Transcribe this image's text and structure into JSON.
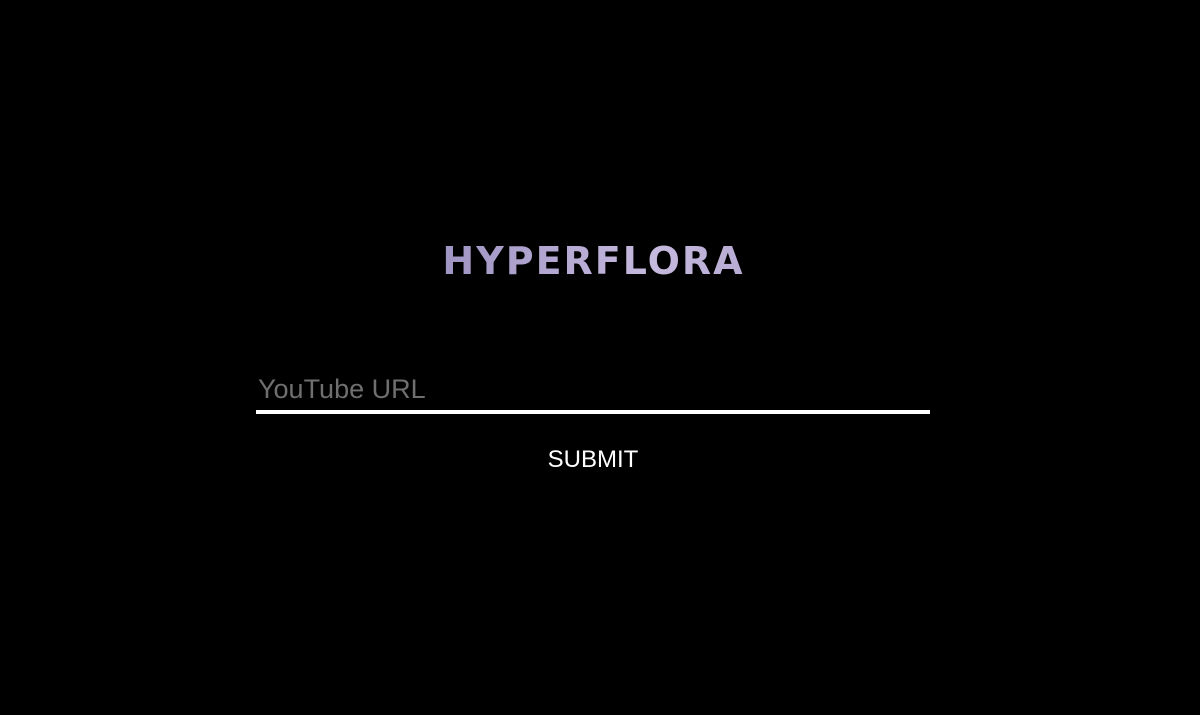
{
  "brand": {
    "logo_text": "HYPERFLORA"
  },
  "form": {
    "url_placeholder": "YouTube URL",
    "url_value": "",
    "submit_label": "SUBMIT"
  },
  "colors": {
    "background": "#000000",
    "underline": "#ffffff",
    "placeholder": "#6f6f6f",
    "button_text": "#ffffff",
    "logo_gradient": [
      "#b8a4d8",
      "#8f86b8",
      "#c6b9de",
      "#9b92bf",
      "#d4cde6"
    ]
  }
}
